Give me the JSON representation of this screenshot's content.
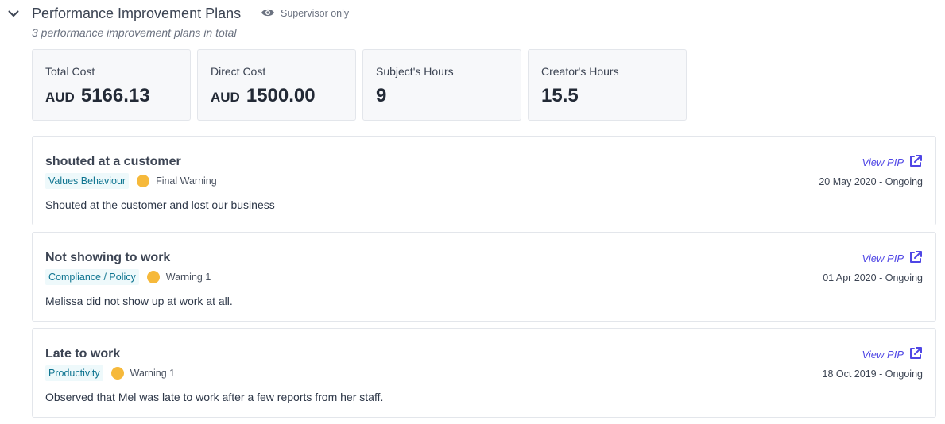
{
  "header": {
    "title": "Performance Improvement Plans",
    "visibility_label": "Supervisor only",
    "subtitle": "3 performance improvement plans in total"
  },
  "stats": [
    {
      "label": "Total Cost",
      "currency": "AUD",
      "value": "5166.13"
    },
    {
      "label": "Direct Cost",
      "currency": "AUD",
      "value": "1500.00"
    },
    {
      "label": "Subject's Hours",
      "currency": "",
      "value": "9"
    },
    {
      "label": "Creator's Hours",
      "currency": "",
      "value": "15.5"
    }
  ],
  "pips": [
    {
      "title": "shouted at a customer",
      "category": "Values Behaviour",
      "level": "Final Warning",
      "description": "Shouted at the customer and lost our business",
      "dates": "20 May 2020 - Ongoing",
      "link_label": "View PIP"
    },
    {
      "title": "Not showing to work",
      "category": "Compliance / Policy",
      "level": "Warning 1",
      "description": "Melissa did not show up at work at all.",
      "dates": "01 Apr 2020 - Ongoing",
      "link_label": "View PIP"
    },
    {
      "title": "Late to work",
      "category": "Productivity",
      "level": "Warning 1",
      "description": "Observed that Mel was late to work after a few reports from her staff.",
      "dates": "18 Oct 2019 - Ongoing",
      "link_label": "View PIP"
    }
  ],
  "icons": {
    "collapse": "chevron-down-icon",
    "visibility": "eye-icon",
    "link": "external-link-icon",
    "status": "status-dot-icon"
  },
  "colors": {
    "accent": "#4f46e5",
    "tag_bg": "#eef9fb",
    "tag_text": "#0e7490",
    "status_dot": "#f6b93b"
  }
}
